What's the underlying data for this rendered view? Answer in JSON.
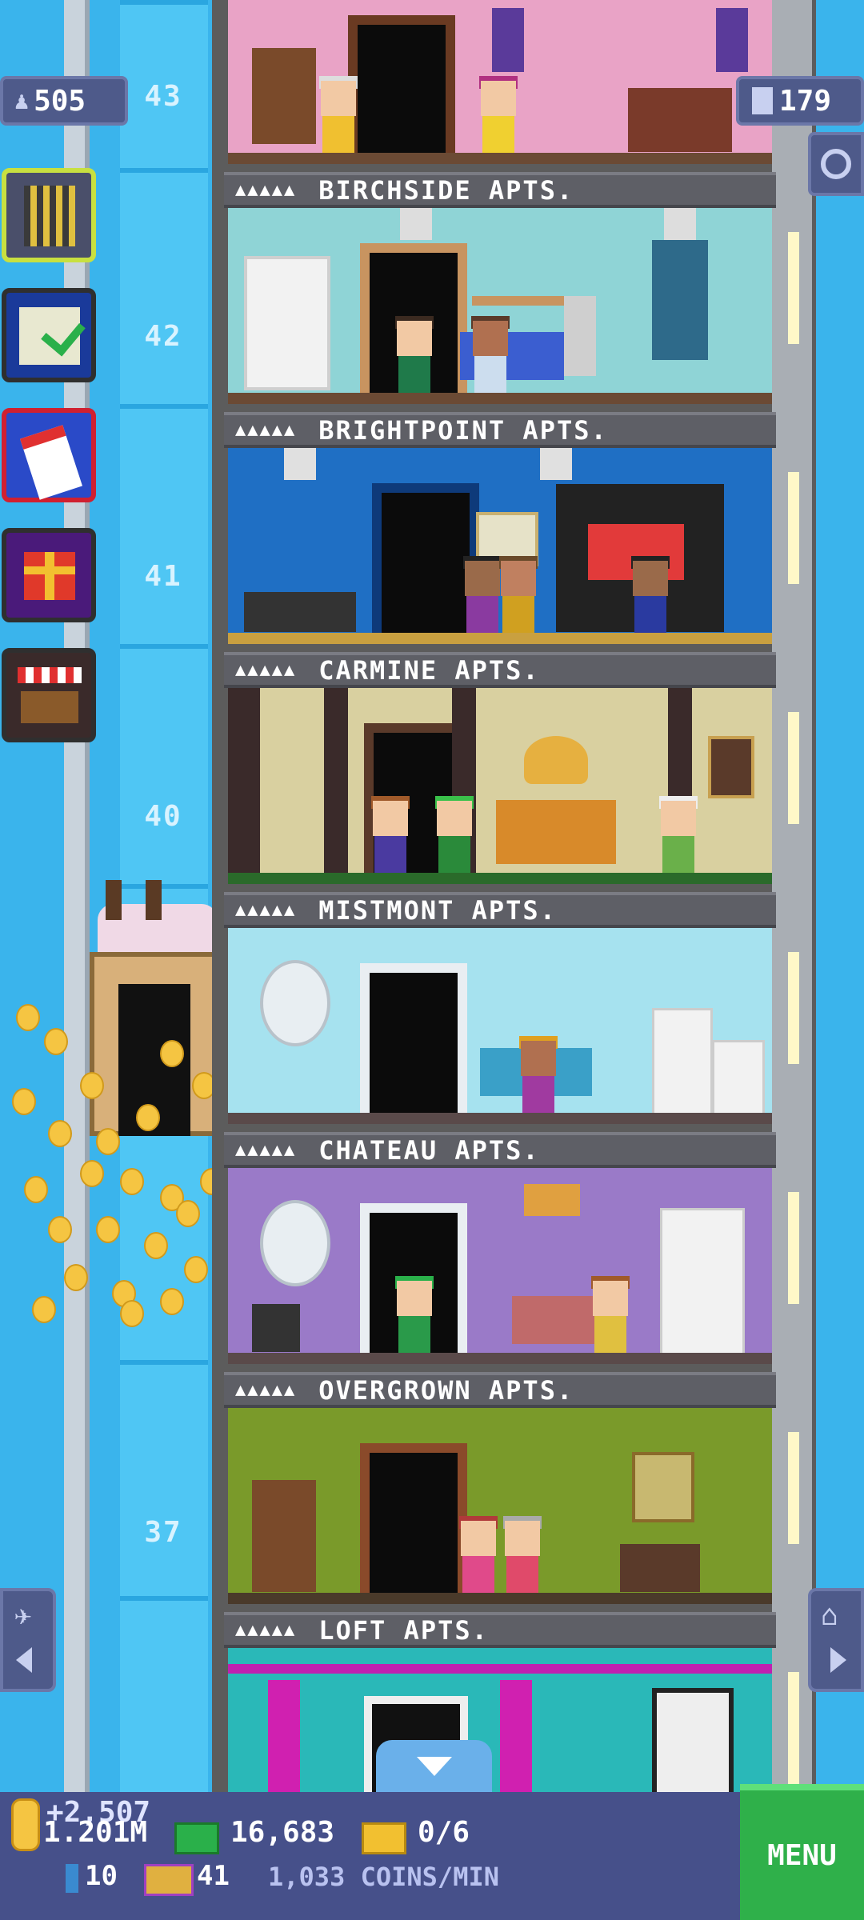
{
  "header": {
    "population": "505",
    "floor_count": "179",
    "population_icon": "person-icon",
    "floors_icon": "building-icon",
    "search_icon": "magnifier-icon"
  },
  "shaft_floor_numbers": [
    "43",
    "42",
    "41",
    "40",
    "37"
  ],
  "side_buttons": [
    {
      "icon": "building-grid-icon"
    },
    {
      "icon": "mission-checklist-icon"
    },
    {
      "icon": "calendar-icon"
    },
    {
      "icon": "gift-icon"
    },
    {
      "icon": "market-stall-icon"
    }
  ],
  "floors": [
    {
      "sign": "BIRCHSIDE APTS."
    },
    {
      "sign": "BRIGHTPOINT APTS."
    },
    {
      "sign": "CARMINE APTS."
    },
    {
      "sign": "MISTMONT APTS."
    },
    {
      "sign": "CHATEAU APTS."
    },
    {
      "sign": "OVERGROWN APTS."
    },
    {
      "sign": "LOFT APTS."
    }
  ],
  "sign_people": "▲▲▲▲▲",
  "bottom": {
    "coins_gain": "+2,507",
    "coins": "1.201M",
    "bux": "16,683",
    "tickets": "0/6",
    "elevator_count": "10",
    "golden_tickets": "41",
    "rate": "1,033 COINS/MIN",
    "menu": "MENU"
  },
  "colors": {
    "sky": "#3ab4ec",
    "sign_bg": "#5e5f66",
    "menu_green": "#2fb04a",
    "bottom_bar": "#46508a"
  }
}
